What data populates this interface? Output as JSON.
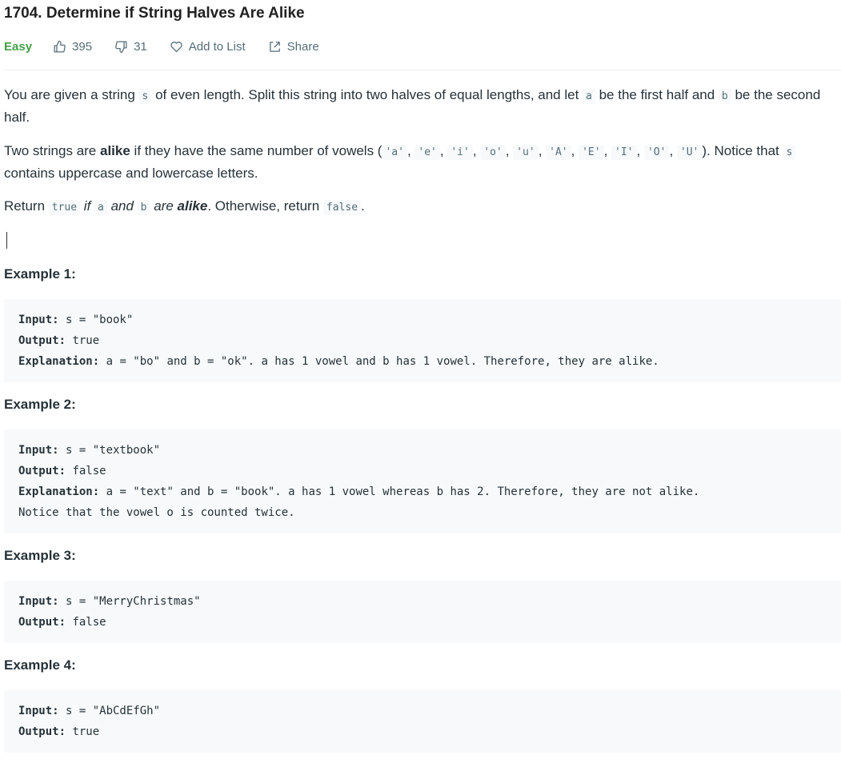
{
  "problem": {
    "title": "1704. Determine if String Halves Are Alike",
    "difficulty": "Easy",
    "likes": "395",
    "dislikes": "31",
    "add_to_list": "Add to List",
    "share": "Share"
  },
  "description": {
    "p1": {
      "t1": "You are given a string ",
      "c1": "s",
      "t2": " of even length. Split this string into two halves of equal lengths, and let ",
      "c2": "a",
      "t3": " be the first half and ",
      "c3": "b",
      "t4": " be the second half."
    },
    "p2": {
      "t1": "Two strings are ",
      "b1": "alike",
      "t2": " if they have the same number of vowels (",
      "vowels": [
        "'a'",
        "'e'",
        "'i'",
        "'o'",
        "'u'",
        "'A'",
        "'E'",
        "'I'",
        "'O'",
        "'U'"
      ],
      "sep": ", ",
      "t3": "). Notice that ",
      "c1": "s",
      "t4": " contains uppercase and lowercase letters."
    },
    "p3": {
      "t1": "Return ",
      "c1": "true",
      "i1": " if ",
      "c2": "a",
      "i2": " and ",
      "c3": "b",
      "i3": " are ",
      "bi": "alike",
      "t2": ". Otherwise, return ",
      "c4": "false",
      "t3": "."
    }
  },
  "examples": [
    {
      "heading": "Example 1:",
      "input_label": "Input:",
      "input": " s = \"book\"",
      "output_label": "Output:",
      "output": " true",
      "explanation_label": "Explanation:",
      "explanation": " a = \"bo\" and b = \"ok\". a has 1 vowel and b has 1 vowel. Therefore, they are alike."
    },
    {
      "heading": "Example 2:",
      "input_label": "Input:",
      "input": " s = \"textbook\"",
      "output_label": "Output:",
      "output": " false",
      "explanation_label": "Explanation:",
      "explanation": " a = \"text\" and b = \"book\". a has 1 vowel whereas b has 2. Therefore, they are not alike.",
      "explanation_cont": "Notice that the vowel o is counted twice."
    },
    {
      "heading": "Example 3:",
      "input_label": "Input:",
      "input": " s = \"MerryChristmas\"",
      "output_label": "Output:",
      "output": " false"
    },
    {
      "heading": "Example 4:",
      "input_label": "Input:",
      "input": " s = \"AbCdEfGh\"",
      "output_label": "Output:",
      "output": " true"
    }
  ]
}
